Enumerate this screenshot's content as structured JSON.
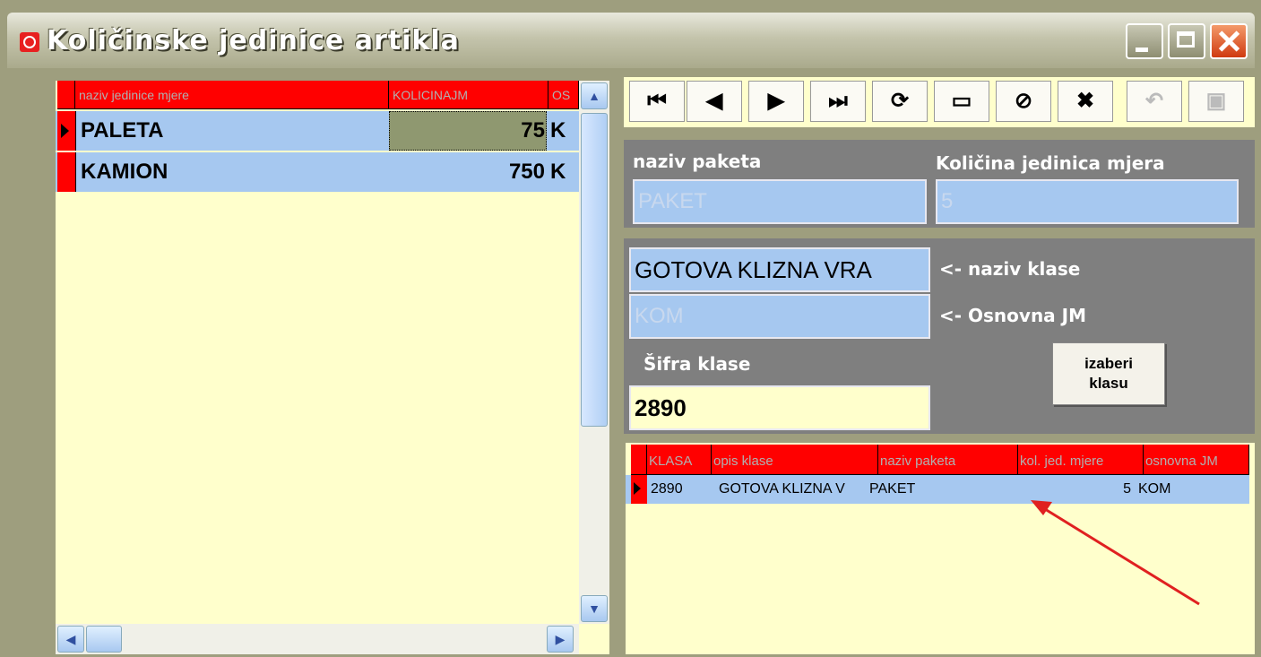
{
  "window": {
    "title": "Količinske jedinice artikla",
    "icons": [
      "minimize-icon",
      "maximize-icon",
      "close-icon"
    ]
  },
  "left_grid": {
    "headers": [
      "naziv jedinice mjere",
      "KOLICINAJM",
      "OS"
    ],
    "rows": [
      {
        "name": "PALETA",
        "qty": "75",
        "os": "K"
      },
      {
        "name": "KAMION",
        "qty": "750",
        "os": "K"
      }
    ]
  },
  "nav": {
    "first": "⏮",
    "prev": "◀",
    "next": "▶",
    "last": "⏭",
    "refresh": "⟳",
    "insert": "▭",
    "hide": "⊘",
    "delete": "✖",
    "undo": "↶",
    "save": "▣"
  },
  "package": {
    "name_label": "naziv paketa",
    "name_value": "PAKET",
    "qty_label": "Količina jedinica mjera",
    "qty_value": "5"
  },
  "klasa": {
    "naziv_value": "GOTOVA KLIZNA VRA",
    "naziv_label": "<- naziv klase",
    "jm_value": "KOM",
    "jm_label": "<- Osnovna JM",
    "sifra_label": "Šifra klase",
    "sifra_value": "2890",
    "choose_line1": "izaberi",
    "choose_line2": "klasu"
  },
  "bottom_grid": {
    "headers": [
      "KLASA",
      "opis klase",
      "naziv paketa",
      "kol. jed. mjere",
      "osnovna JM"
    ],
    "row": {
      "klasa": "2890",
      "opis": "GOTOVA KLIZNA V",
      "paket": "PAKET",
      "kol": "5",
      "jm": "KOM"
    }
  },
  "colors": {
    "header_red": "#ff0000",
    "row_blue": "#a6c8f0",
    "panel_gray": "#7f7f7f",
    "bg_yellow": "#ffffcc",
    "annotation": "#e02020"
  }
}
